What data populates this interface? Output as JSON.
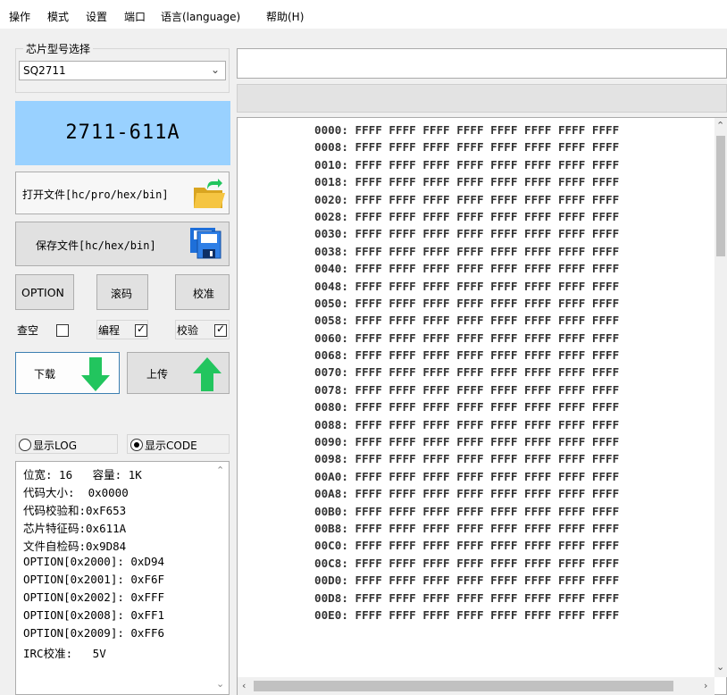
{
  "menu": [
    "操作",
    "模式",
    "设置",
    "端口",
    "语言(language)",
    "帮助(H)"
  ],
  "chip_group": {
    "title": "芯片型号选择",
    "selected": "SQ2711"
  },
  "chip_display": "2711-611A",
  "buttons": {
    "open_file": "打开文件[hc/pro/hex/bin]",
    "save_file": "保存文件[hc/hex/bin]",
    "option": "OPTION",
    "scramble": "滚码",
    "calibrate": "校准",
    "download": "下载",
    "upload": "上传"
  },
  "checkboxes": {
    "blank_check": {
      "label": "查空",
      "checked": false
    },
    "program": {
      "label": "编程",
      "checked": true
    },
    "verify": {
      "label": "校验",
      "checked": true
    }
  },
  "radios": {
    "show_log": {
      "label": "显示LOG",
      "selected": false
    },
    "show_code": {
      "label": "显示CODE",
      "selected": true
    }
  },
  "info_lines": [
    "位宽: 16   容量: 1K",
    "代码大小:  0x0000",
    "代码校验和:0xF653",
    "芯片特征码:0x611A",
    "文件自检码:0x9D84",
    "OPTION[0x2000]: 0xD94",
    "OPTION[0x2001]: 0xF6F",
    "OPTION[0x2002]: 0xFFF",
    "OPTION[0x2008]: 0xFF1",
    "OPTION[0x2009]: 0xFF6",
    "IRC校准:   5V"
  ],
  "hex_rows": [
    "0000: FFFF FFFF FFFF FFFF FFFF FFFF FFFF FFFF",
    "0008: FFFF FFFF FFFF FFFF FFFF FFFF FFFF FFFF",
    "0010: FFFF FFFF FFFF FFFF FFFF FFFF FFFF FFFF",
    "0018: FFFF FFFF FFFF FFFF FFFF FFFF FFFF FFFF",
    "0020: FFFF FFFF FFFF FFFF FFFF FFFF FFFF FFFF",
    "0028: FFFF FFFF FFFF FFFF FFFF FFFF FFFF FFFF",
    "0030: FFFF FFFF FFFF FFFF FFFF FFFF FFFF FFFF",
    "0038: FFFF FFFF FFFF FFFF FFFF FFFF FFFF FFFF",
    "0040: FFFF FFFF FFFF FFFF FFFF FFFF FFFF FFFF",
    "0048: FFFF FFFF FFFF FFFF FFFF FFFF FFFF FFFF",
    "0050: FFFF FFFF FFFF FFFF FFFF FFFF FFFF FFFF",
    "0058: FFFF FFFF FFFF FFFF FFFF FFFF FFFF FFFF",
    "0060: FFFF FFFF FFFF FFFF FFFF FFFF FFFF FFFF",
    "0068: FFFF FFFF FFFF FFFF FFFF FFFF FFFF FFFF",
    "0070: FFFF FFFF FFFF FFFF FFFF FFFF FFFF FFFF",
    "0078: FFFF FFFF FFFF FFFF FFFF FFFF FFFF FFFF",
    "0080: FFFF FFFF FFFF FFFF FFFF FFFF FFFF FFFF",
    "0088: FFFF FFFF FFFF FFFF FFFF FFFF FFFF FFFF",
    "0090: FFFF FFFF FFFF FFFF FFFF FFFF FFFF FFFF",
    "0098: FFFF FFFF FFFF FFFF FFFF FFFF FFFF FFFF",
    "00A0: FFFF FFFF FFFF FFFF FFFF FFFF FFFF FFFF",
    "00A8: FFFF FFFF FFFF FFFF FFFF FFFF FFFF FFFF",
    "00B0: FFFF FFFF FFFF FFFF FFFF FFFF FFFF FFFF",
    "00B8: FFFF FFFF FFFF FFFF FFFF FFFF FFFF FFFF",
    "00C0: FFFF FFFF FFFF FFFF FFFF FFFF FFFF FFFF",
    "00C8: FFFF FFFF FFFF FFFF FFFF FFFF FFFF FFFF",
    "00D0: FFFF FFFF FFFF FFFF FFFF FFFF FFFF FFFF",
    "00D8: FFFF FFFF FFFF FFFF FFFF FFFF FFFF FFFF",
    "00E0: FFFF FFFF FFFF FFFF FFFF FFFF FFFF FFFF"
  ],
  "icons": {
    "open_file": "folder-open-icon",
    "save_file": "floppy-save-icon",
    "download": "arrow-down-icon",
    "upload": "arrow-up-icon",
    "select": "chevron-down-icon"
  },
  "colors": {
    "chip_display_bg": "#99d1ff",
    "arrow_green": "#22c55e",
    "folder_yellow": "#f5c542",
    "floppy_blue": "#1e6fd9"
  }
}
